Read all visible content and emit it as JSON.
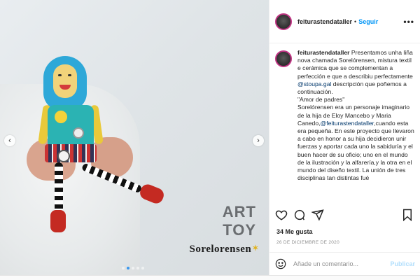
{
  "post": {
    "username": "feiturastendataller",
    "follow_label": "Seguir",
    "separator": "•",
    "more_label": "•••",
    "art_toy_line1": "ART",
    "art_toy_line2": "TOY",
    "brand_text": "Sorelorensen",
    "caption_before_link": "Presentamos unha liña nova chamada Sorelórensen, mistura textil e cerámica que se complementan a perfección e que a describiu perfectamente ",
    "caption_link": "@stoupa.gal",
    "caption_after_link": " descripción que poñemos a continuación.\n\"Amor de padres\"\nSorelórensen era un personaje imaginario de la hija de Eloy Mancebo y Maria Canedo,",
    "caption_link2": "@feiturastendataller",
    "caption_end": ",cuando esta era pequeña. En este proyecto que llevaron a cabo en honor a su hija decidieron unir fuerzas y aportar cada uno la sabiduría y el buen hacer de su oficio; uno en el mundo de la ilustración y la alfarería,y la otra en el mundo del diseño textil. La unión de tres disciplinas tan distintas fué",
    "likes": "34 Me gusta",
    "date": "26 DE DICIEMBRE DE 2020",
    "comment_placeholder": "Añade un comentario...",
    "publish_label": "Publicar"
  },
  "icons": {
    "heart": "heart-icon",
    "comment": "comment-icon",
    "share": "paper-plane-icon",
    "save": "bookmark-icon",
    "emoji": "smiley-icon",
    "prev": "chevron-left-icon",
    "next": "chevron-right-icon"
  },
  "colors": {
    "link_blue": "#0095f6",
    "mention": "#00376b",
    "muted": "#8e8e8e",
    "active_dot": "#3a97ee"
  }
}
